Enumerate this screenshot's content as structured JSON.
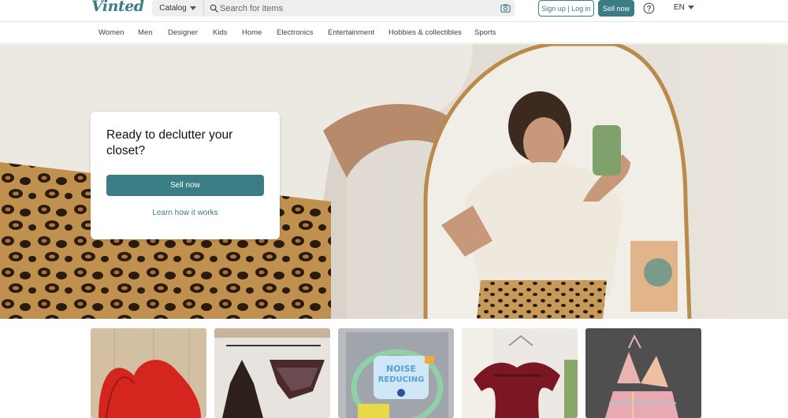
{
  "header": {
    "logo": "Vinted",
    "catalog_label": "Catalog",
    "search_placeholder": "Search for items",
    "signup_label": "Sign up | Log in",
    "sell_label": "Sell now",
    "language": "EN"
  },
  "nav": {
    "categories": [
      "Women",
      "Men",
      "Designer",
      "Kids",
      "Home",
      "Electronics",
      "Entertainment",
      "Hobbies & collectibles",
      "Sports"
    ]
  },
  "hero": {
    "title": "Ready to declutter your closet?",
    "sell_label": "Sell now",
    "learn_label": "Learn how it works"
  },
  "products": [
    {
      "name": "red-bikini-top"
    },
    {
      "name": "brown-bikini-set"
    },
    {
      "name": "noise-reducing-earmuffs"
    },
    {
      "name": "burgundy-ruffle-top"
    },
    {
      "name": "plaid-halter-top"
    }
  ],
  "colors": {
    "brand": "#3a7d84",
    "search_bg": "#efefef"
  }
}
